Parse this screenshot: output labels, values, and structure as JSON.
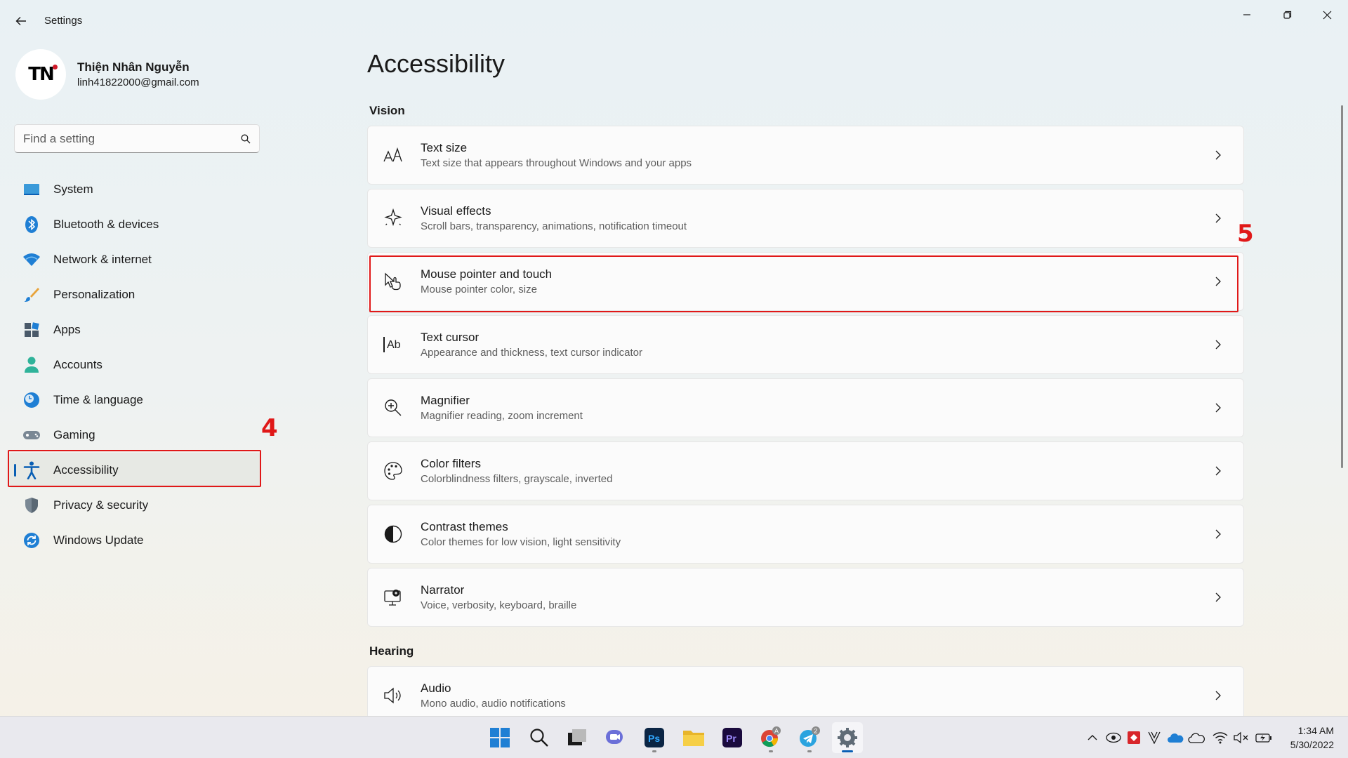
{
  "window": {
    "title": "Settings"
  },
  "profile": {
    "initials": "TN",
    "name": "Thiện Nhân Nguyễn",
    "email": "linh41822000@gmail.com"
  },
  "search": {
    "placeholder": "Find a setting"
  },
  "sidebar": {
    "items": [
      {
        "label": "System",
        "icon": "system-icon"
      },
      {
        "label": "Bluetooth & devices",
        "icon": "bluetooth-icon"
      },
      {
        "label": "Network & internet",
        "icon": "wifi-icon"
      },
      {
        "label": "Personalization",
        "icon": "brush-icon"
      },
      {
        "label": "Apps",
        "icon": "apps-icon"
      },
      {
        "label": "Accounts",
        "icon": "person-icon"
      },
      {
        "label": "Time & language",
        "icon": "clock-globe-icon"
      },
      {
        "label": "Gaming",
        "icon": "gamepad-icon"
      },
      {
        "label": "Accessibility",
        "icon": "accessibility-icon",
        "active": true
      },
      {
        "label": "Privacy & security",
        "icon": "shield-icon"
      },
      {
        "label": "Windows Update",
        "icon": "update-icon"
      }
    ]
  },
  "annotations": {
    "step4": "4",
    "step5": "5",
    "color": "#e01818"
  },
  "main": {
    "title": "Accessibility",
    "sections": [
      {
        "label": "Vision",
        "items": [
          {
            "title": "Text size",
            "subtitle": "Text size that appears throughout Windows and your apps",
            "icon": "text-size-icon"
          },
          {
            "title": "Visual effects",
            "subtitle": "Scroll bars, transparency, animations, notification timeout",
            "icon": "sparkle-icon"
          },
          {
            "title": "Mouse pointer and touch",
            "subtitle": "Mouse pointer color, size",
            "icon": "pointer-hand-icon"
          },
          {
            "title": "Text cursor",
            "subtitle": "Appearance and thickness, text cursor indicator",
            "icon": "text-cursor-icon"
          },
          {
            "title": "Magnifier",
            "subtitle": "Magnifier reading, zoom increment",
            "icon": "magnifier-icon"
          },
          {
            "title": "Color filters",
            "subtitle": "Colorblindness filters, grayscale, inverted",
            "icon": "palette-icon"
          },
          {
            "title": "Contrast themes",
            "subtitle": "Color themes for low vision, light sensitivity",
            "icon": "contrast-icon"
          },
          {
            "title": "Narrator",
            "subtitle": "Voice, verbosity, keyboard, braille",
            "icon": "narrator-icon"
          }
        ]
      },
      {
        "label": "Hearing",
        "items": [
          {
            "title": "Audio",
            "subtitle": "Mono audio, audio notifications",
            "icon": "speaker-icon"
          }
        ]
      }
    ]
  },
  "taskbar": {
    "apps": [
      "start-icon",
      "search-icon",
      "task-view-icon",
      "chat-icon",
      "photoshop-icon",
      "file-explorer-icon",
      "premiere-icon",
      "chrome-icon",
      "telegram-icon",
      "settings-icon"
    ],
    "labels": {
      "photoshop": "Ps",
      "premiere": "Pr",
      "chrome_badge": "A",
      "telegram_badge": "2"
    },
    "time": "1:34 AM",
    "date": "5/30/2022"
  },
  "colors": {
    "accent": "#0a5fb4",
    "highlight": "#e01818"
  }
}
